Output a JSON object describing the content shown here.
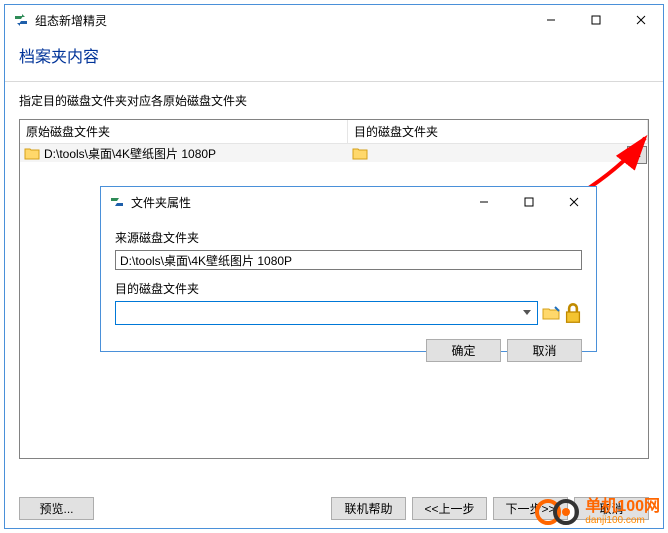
{
  "main": {
    "title": "组态新增精灵",
    "header": "档案夹内容",
    "subtitle": "指定目的磁盘文件夹对应各原始磁盘文件夹",
    "col_source": "原始磁盘文件夹",
    "col_dest": "目的磁盘文件夹",
    "row_source_path": "D:\\tools\\桌面\\4K壁纸图片 1080P",
    "row_dest_path": "",
    "ellipsis": "...",
    "preview": "预览...",
    "help": "联机帮助",
    "back": "<<上一步",
    "next": "下一步>>",
    "cancel": "取消"
  },
  "dialog": {
    "title": "文件夹属性",
    "src_label": "来源磁盘文件夹",
    "src_value": "D:\\tools\\桌面\\4K壁纸图片 1080P",
    "dest_label": "目的磁盘文件夹",
    "dest_value": "",
    "ok": "确定",
    "cancel": "取消"
  },
  "watermark": {
    "cn": "单机100网",
    "en": "danji100.com"
  }
}
